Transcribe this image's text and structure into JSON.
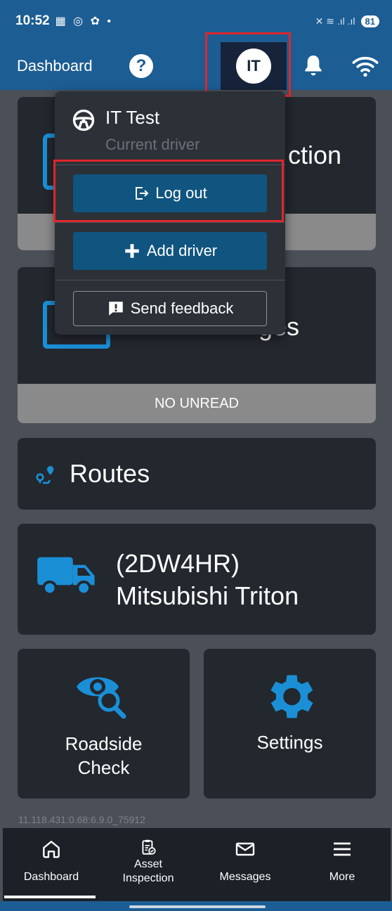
{
  "status_bar": {
    "time": "10:52",
    "left_icons": "▦ ◎ ✿ •",
    "right_icons": "✕ ≋ .ıl .ıl",
    "battery": "81"
  },
  "header": {
    "title": "Dashboard",
    "help": "?",
    "avatar_initials": "IT"
  },
  "cards": {
    "inspection": {
      "title_fragment": "ction"
    },
    "messages": {
      "title_fragment": "ges",
      "footer": "NO UNREAD"
    },
    "routes": {
      "title": "Routes"
    },
    "vehicle": {
      "line1": "(2DW4HR)",
      "line2": "Mitsubishi Triton"
    },
    "roadside": {
      "line1": "Roadside",
      "line2": "Check"
    },
    "settings": {
      "title": "Settings"
    }
  },
  "dropdown": {
    "name": "IT Test",
    "subtitle": "Current driver",
    "logout_label": "Log out",
    "add_driver_label": "Add driver",
    "feedback_label": "Send feedback"
  },
  "version": "11.118.431:0.68:6.9.0_75912",
  "bottom_nav": {
    "dashboard": "Dashboard",
    "asset_line1": "Asset",
    "asset_line2": "Inspection",
    "messages": "Messages",
    "more": "More"
  },
  "colors": {
    "header": "#1c5d93",
    "accent": "#1a8fd6",
    "highlight": "#e0262b",
    "card": "#23272e",
    "button": "#0f557f"
  }
}
